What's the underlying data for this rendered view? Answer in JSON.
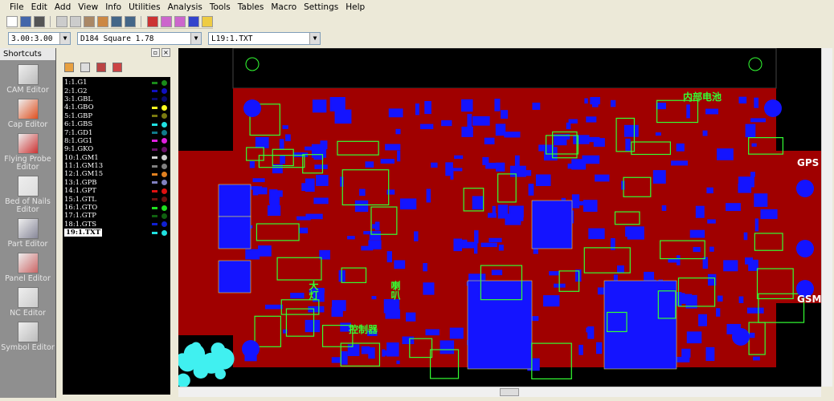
{
  "menu": [
    "File",
    "Edit",
    "Add",
    "View",
    "Info",
    "Utilities",
    "Analysis",
    "Tools",
    "Tables",
    "Macro",
    "Settings",
    "Help"
  ],
  "toolbar_icons": [
    "new-icon",
    "open-icon",
    "save-icon",
    "undo-icon",
    "redo-icon",
    "layers-icon",
    "paint-icon",
    "zoom-in-icon",
    "zoom-out-icon",
    "insert-icon",
    "grid-icon",
    "grid2-icon",
    "color-icon",
    "palette-icon"
  ],
  "combos": {
    "grid": "3.00:3.00",
    "aperture": "D184  Square 1.78",
    "layer": "L19:1.TXT"
  },
  "shortcuts": {
    "title": "Shortcuts",
    "items": [
      "CAM Editor",
      "Cap Editor",
      "Flying Probe Editor",
      "Bed of Nails Editor",
      "Part Editor",
      "Panel Editor",
      "NC Editor",
      "Symbol Editor"
    ]
  },
  "layers": [
    {
      "name": "1:1.G1",
      "color": "#1a8a1a"
    },
    {
      "name": "2:1.G2",
      "color": "#1010c0"
    },
    {
      "name": "3:1.GBL",
      "color": "#0a0a70"
    },
    {
      "name": "4:1.GBO",
      "color": "#ffff20"
    },
    {
      "name": "5:1.GBP",
      "color": "#7a7a10"
    },
    {
      "name": "6:1.GBS",
      "color": "#20e0e0"
    },
    {
      "name": "7:1.GD1",
      "color": "#107a8a"
    },
    {
      "name": "8:1.GG1",
      "color": "#e020e0"
    },
    {
      "name": "9:1.GKO",
      "color": "#6a106a"
    },
    {
      "name": "10:1.GM1",
      "color": "#d0d0d0"
    },
    {
      "name": "11:1.GM13",
      "color": "#808080"
    },
    {
      "name": "12:1.GM15",
      "color": "#e08020"
    },
    {
      "name": "13:1.GPB",
      "color": "#8080c0"
    },
    {
      "name": "14:1.GPT",
      "color": "#e01010"
    },
    {
      "name": "15:1.GTL",
      "color": "#701010"
    },
    {
      "name": "16:1.GTO",
      "color": "#20e020"
    },
    {
      "name": "17:1.GTP",
      "color": "#106010"
    },
    {
      "name": "18:1.GTS",
      "color": "#1020d0"
    },
    {
      "name": "19:1.TXT",
      "color": "#20e0e0",
      "selected": true
    }
  ],
  "board_labels": {
    "gps": "GPS",
    "gsm": "GSM",
    "battery": "内部电池",
    "controller": "控制器",
    "horn": "喇叭",
    "light": "大灯"
  },
  "colors": {
    "board": "#a00000",
    "pad": "#1414ff",
    "silk": "#33ff33",
    "background": "#000000"
  }
}
